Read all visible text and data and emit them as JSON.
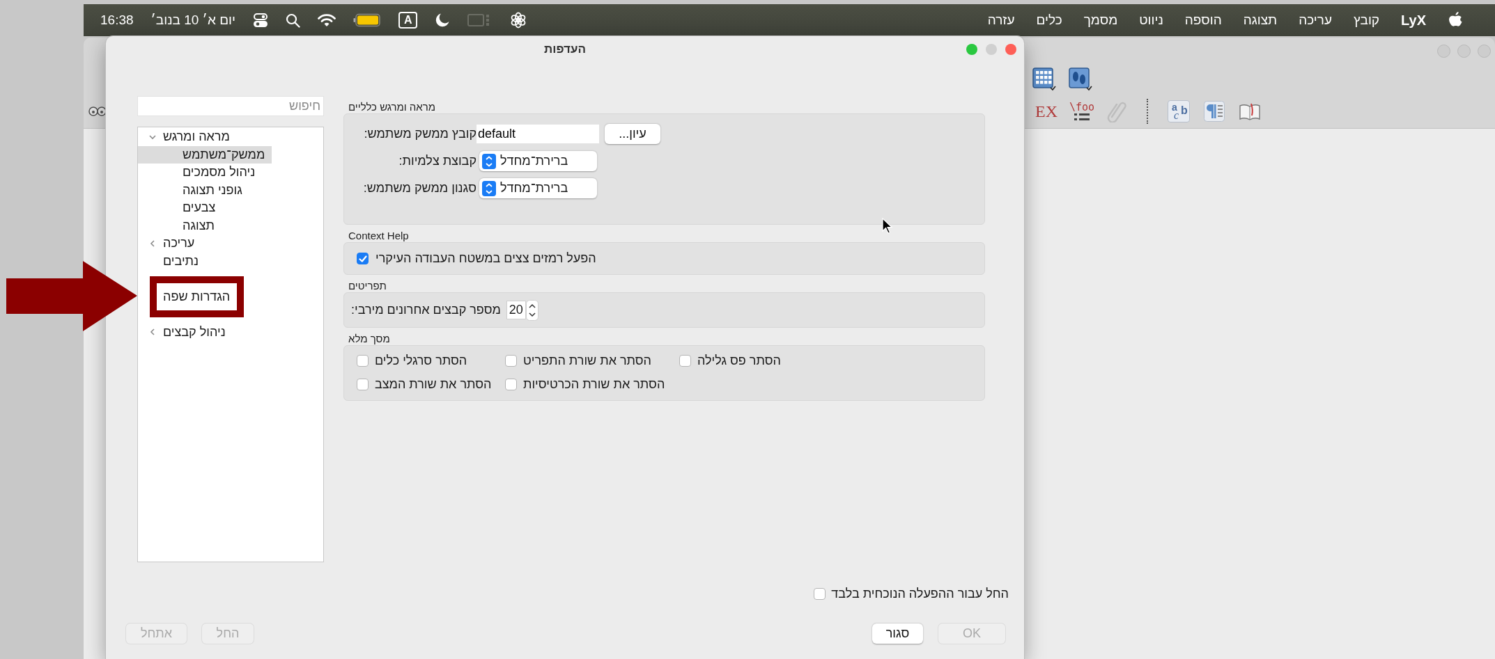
{
  "menu_bar": {
    "app_name": "LyX",
    "menus": [
      "קובץ",
      "עריכה",
      "תצוגה",
      "הוספה",
      "ניווט",
      "מסמך",
      "כלים",
      "עזרה"
    ],
    "input_source": "A",
    "date": "יום א׳ 10 בנוב׳",
    "clock": "16:38"
  },
  "background_window": {
    "toolbar_top": [
      {
        "kind": "feet"
      },
      {
        "kind": "table"
      }
    ],
    "toolbar_bottom": [
      {
        "kind": "book"
      },
      {
        "kind": "pilcrow"
      },
      {
        "kind": "letters",
        "glyphs": [
          "a",
          "c",
          "b"
        ]
      },
      {
        "kind": "separator"
      },
      {
        "kind": "paperclip"
      },
      {
        "kind": "macro",
        "glyphs": [
          "\\foo"
        ]
      },
      {
        "kind": "tex",
        "glyphs": [
          "EX"
        ]
      },
      {
        "kind": "glasses"
      }
    ]
  },
  "dialog": {
    "title": "העדפות",
    "search": {
      "placeholder": "חיפוש"
    },
    "tree": [
      {
        "label": "מראה ומרגש",
        "kind": "item",
        "selected": false,
        "expanded": true,
        "children": [
          {
            "label": "ממשק־משתמש",
            "kind": "item",
            "selected": true
          },
          {
            "label": "ניהול מסמכים",
            "kind": "item",
            "selected": false
          },
          {
            "label": "גופני תצוגה",
            "kind": "item",
            "selected": false
          },
          {
            "label": "צבעים",
            "kind": "item",
            "selected": false
          },
          {
            "label": "תצוגה",
            "kind": "item",
            "selected": false
          }
        ]
      },
      {
        "label": "עריכה",
        "kind": "item",
        "selected": false,
        "expanded": false
      },
      {
        "label": "נתיבים",
        "kind": "item",
        "selected": false
      },
      {
        "kind": "obscured"
      },
      {
        "label": "הגדרות שפה",
        "kind": "item",
        "selected": false
      },
      {
        "kind": "obscured"
      },
      {
        "label": "ניהול קבצים",
        "kind": "item",
        "selected": false,
        "expanded": false
      }
    ],
    "groups": [
      {
        "title": "מראה ומרגש כלליים",
        "kind": "form",
        "rows": [
          {
            "kind": "file",
            "label": "קובץ ממשק משתמש:",
            "value": "default",
            "button": "...עיון"
          },
          {
            "kind": "combo",
            "label": "קבוצת צלמיות:",
            "value": "ברירת־מחדל"
          },
          {
            "kind": "combo",
            "label": "סגנון ממשק משתמש:",
            "value": "ברירת־מחדל"
          }
        ]
      },
      {
        "title": "Context Help",
        "kind": "form",
        "rows": [
          {
            "kind": "checkbox",
            "label": "הפעל רמזים צצים במשטח העבודה העיקרי",
            "checked": true
          }
        ]
      },
      {
        "title": "תפריטים",
        "kind": "form",
        "rows": [
          {
            "kind": "spin",
            "label": "מספר קבצים אחרונים מירבי:",
            "value": "20"
          }
        ]
      },
      {
        "title": "מסך מלא",
        "kind": "grid",
        "columns": [
          [
            {
              "label": "הסתר פס גלילה",
              "checked": false
            }
          ],
          [
            {
              "label": "הסתר את שורת התפריט",
              "checked": false
            },
            {
              "label": "הסתר את שורת הכרטיסיות",
              "checked": false
            }
          ],
          [
            {
              "label": "הסתר סרגלי כלים",
              "checked": false
            },
            {
              "label": "הסתר את שורת המצב",
              "checked": false
            }
          ]
        ]
      }
    ],
    "session_only": {
      "label": "החל עבור ההפעלה הנוכחית בלבד",
      "checked": false
    },
    "left_buttons": [
      {
        "label": "החל",
        "disabled": true
      },
      {
        "label": "אתחל",
        "disabled": true
      }
    ],
    "right_buttons": [
      {
        "label": "OK",
        "disabled": true
      },
      {
        "label": "סגור",
        "disabled": false
      }
    ]
  },
  "annotation": {
    "kind": "arrow-frame"
  }
}
